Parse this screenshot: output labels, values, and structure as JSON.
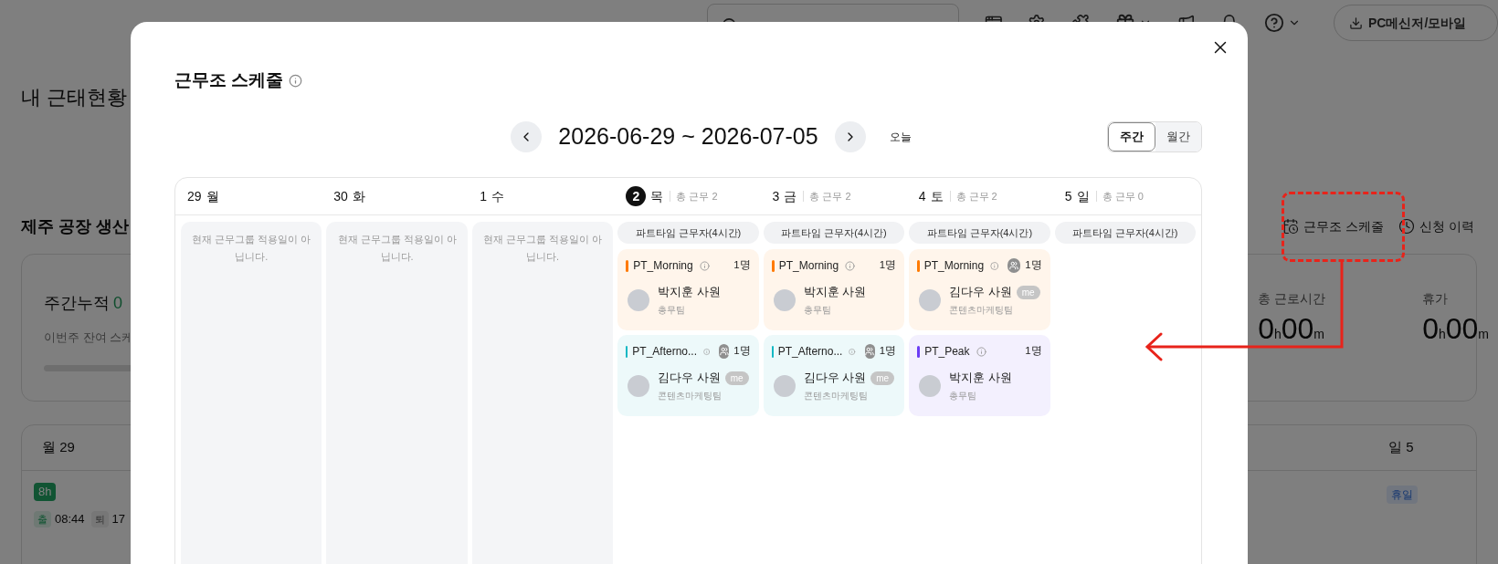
{
  "topbar": {
    "download_button": "PC메신저/모바일"
  },
  "page": {
    "title": "내 근태현황",
    "section_title": "제주 공장 생산",
    "actions": [
      {
        "kind": "schedule",
        "label": "근무조 스케줄"
      },
      {
        "kind": "history",
        "label": "신청 이력"
      }
    ],
    "summary": {
      "weekly_label": "주간누적",
      "weekly_value": "0",
      "remaining": "이번주 잔여 스케",
      "level": 0,
      "stats": [
        {
          "label": "총 근로시간",
          "hours": "0",
          "hour_unit": "h",
          "minutes": "00",
          "minute_unit": "m"
        },
        {
          "label": "휴가",
          "hours": "0",
          "hour_unit": "h",
          "minutes": "00",
          "minute_unit": "m"
        }
      ]
    },
    "week": {
      "first_day": "월 29",
      "hours_badge": "8h",
      "in_label": "출",
      "in_time": "08:44",
      "out_label": "퇴",
      "out_time": "17",
      "last_day": "일 5",
      "last_badge": "휴일"
    }
  },
  "modal": {
    "title": "근무조 스케줄",
    "date_range": "2026-06-29 ~ 2026-07-05",
    "today_button": "오늘",
    "view_tabs": [
      {
        "label": "주간",
        "selected": true
      },
      {
        "label": "월간",
        "selected": false
      }
    ],
    "days": [
      {
        "date": "29",
        "weekday": "월",
        "today": false,
        "notice": "현재 근무그룹 적용일이 아닙니다."
      },
      {
        "date": "30",
        "weekday": "화",
        "today": false,
        "notice": "현재 근무그룹 적용일이 아닙니다."
      },
      {
        "date": "1",
        "weekday": "수",
        "today": false,
        "notice": "현재 근무그룹 적용일이 아닙니다."
      },
      {
        "date": "2",
        "weekday": "목",
        "today": true,
        "total": "총 근무 2",
        "group": "파트타임 근무자(4시간)",
        "shifts": [
          {
            "name": "PT_Morning",
            "color": "#ff7a00",
            "group_icon": false,
            "count": "1명",
            "members": [
              {
                "name": "박지훈 사원",
                "team": "총무팀"
              }
            ]
          },
          {
            "name": "PT_Afterno...",
            "color": "#14b8c4",
            "group_icon": true,
            "count": "1명",
            "members": [
              {
                "name": "김다우 사원",
                "team": "콘텐츠마케팅팀",
                "badge": "me"
              }
            ]
          }
        ]
      },
      {
        "date": "3",
        "weekday": "금",
        "today": false,
        "total": "총 근무 2",
        "group": "파트타임 근무자(4시간)",
        "shifts": [
          {
            "name": "PT_Morning",
            "color": "#ff7a00",
            "group_icon": false,
            "count": "1명",
            "members": [
              {
                "name": "박지훈 사원",
                "team": "총무팀"
              }
            ]
          },
          {
            "name": "PT_Afterno...",
            "color": "#14b8c4",
            "group_icon": true,
            "count": "1명",
            "members": [
              {
                "name": "김다우 사원",
                "team": "콘텐츠마케팅팀",
                "badge": "me"
              }
            ]
          }
        ]
      },
      {
        "date": "4",
        "weekday": "토",
        "today": false,
        "total": "총 근무 2",
        "group": "파트타임 근무자(4시간)",
        "shifts": [
          {
            "name": "PT_Morning",
            "color": "#ff7a00",
            "group_icon": true,
            "count": "1명",
            "members": [
              {
                "name": "김다우 사원",
                "team": "콘텐츠마케팅팀",
                "badge": "me"
              }
            ]
          },
          {
            "name": "PT_Peak",
            "color": "#6b3cf5",
            "group_icon": false,
            "count": "1명",
            "members": [
              {
                "name": "박지훈 사원",
                "team": "총무팀"
              }
            ]
          }
        ]
      },
      {
        "date": "5",
        "weekday": "일",
        "today": false,
        "total": "총 근무 0",
        "group": "파트타임 근무자(4시간)"
      }
    ]
  }
}
